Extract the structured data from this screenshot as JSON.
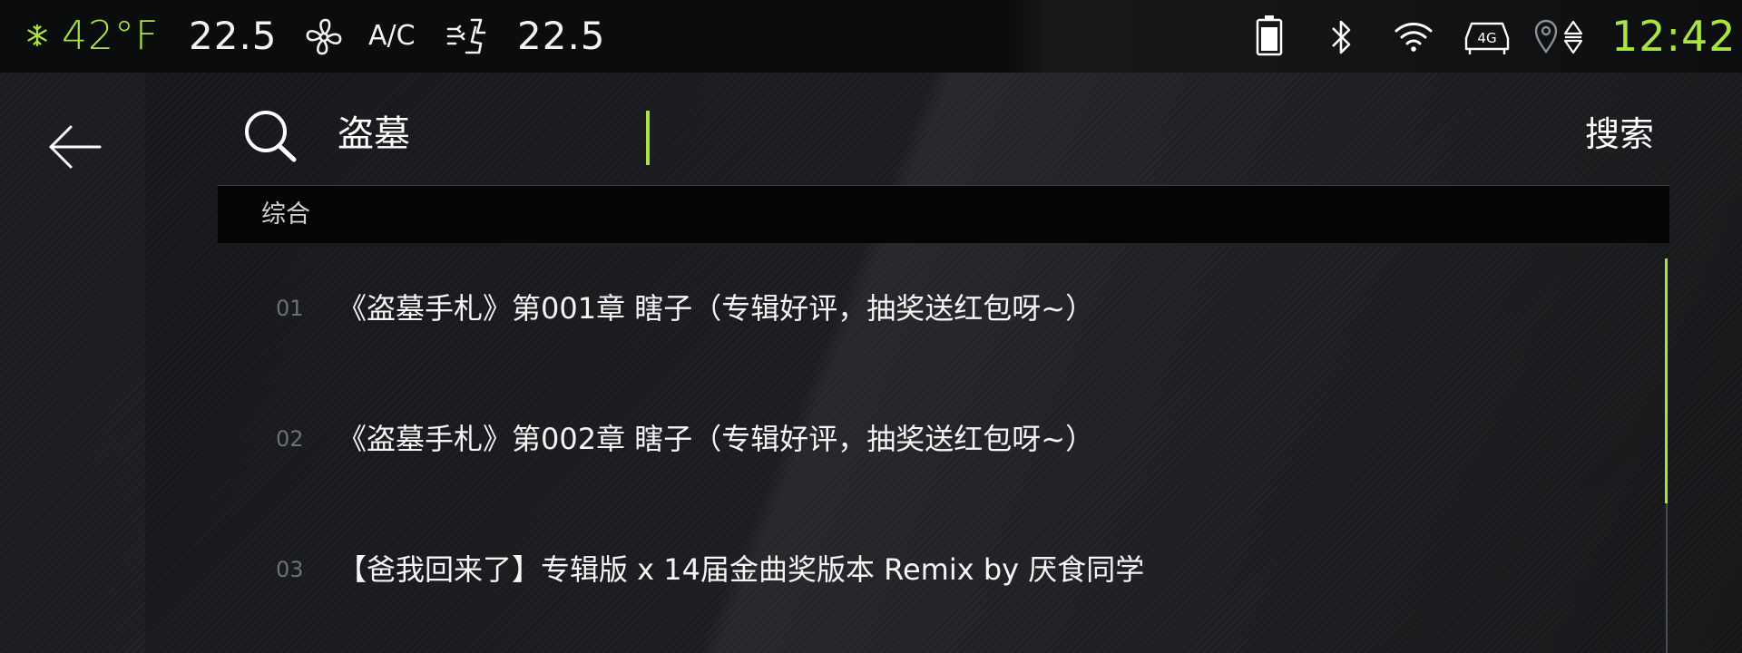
{
  "status_bar": {
    "outside_temp": "42°F",
    "temp_left": "22.5",
    "ac_label": "A/C",
    "temp_right": "22.5",
    "clock": "12:42",
    "network_label": "4G",
    "icons": [
      "snowflake-icon",
      "fan-icon",
      "seat-airflow-icon",
      "battery-icon",
      "bluetooth-icon",
      "wifi-icon",
      "4g-car-icon",
      "location-icon",
      "sort-arrows-icon"
    ]
  },
  "search": {
    "query": "盗墓",
    "button_label": "搜索"
  },
  "tabs": {
    "all_label": "综合"
  },
  "results": [
    {
      "index": "01",
      "title": "《盗墓手札》第001章 瞎子（专辑好评，抽奖送红包呀~）"
    },
    {
      "index": "02",
      "title": "《盗墓手札》第002章 瞎子（专辑好评，抽奖送红包呀~）"
    },
    {
      "index": "03",
      "title": "【爸我回来了】专辑版 x 14届金曲奖版本 Remix by 厌食同学"
    }
  ],
  "colors": {
    "accent": "#a9e43f",
    "background": "#141517",
    "text": "#ffffff"
  }
}
